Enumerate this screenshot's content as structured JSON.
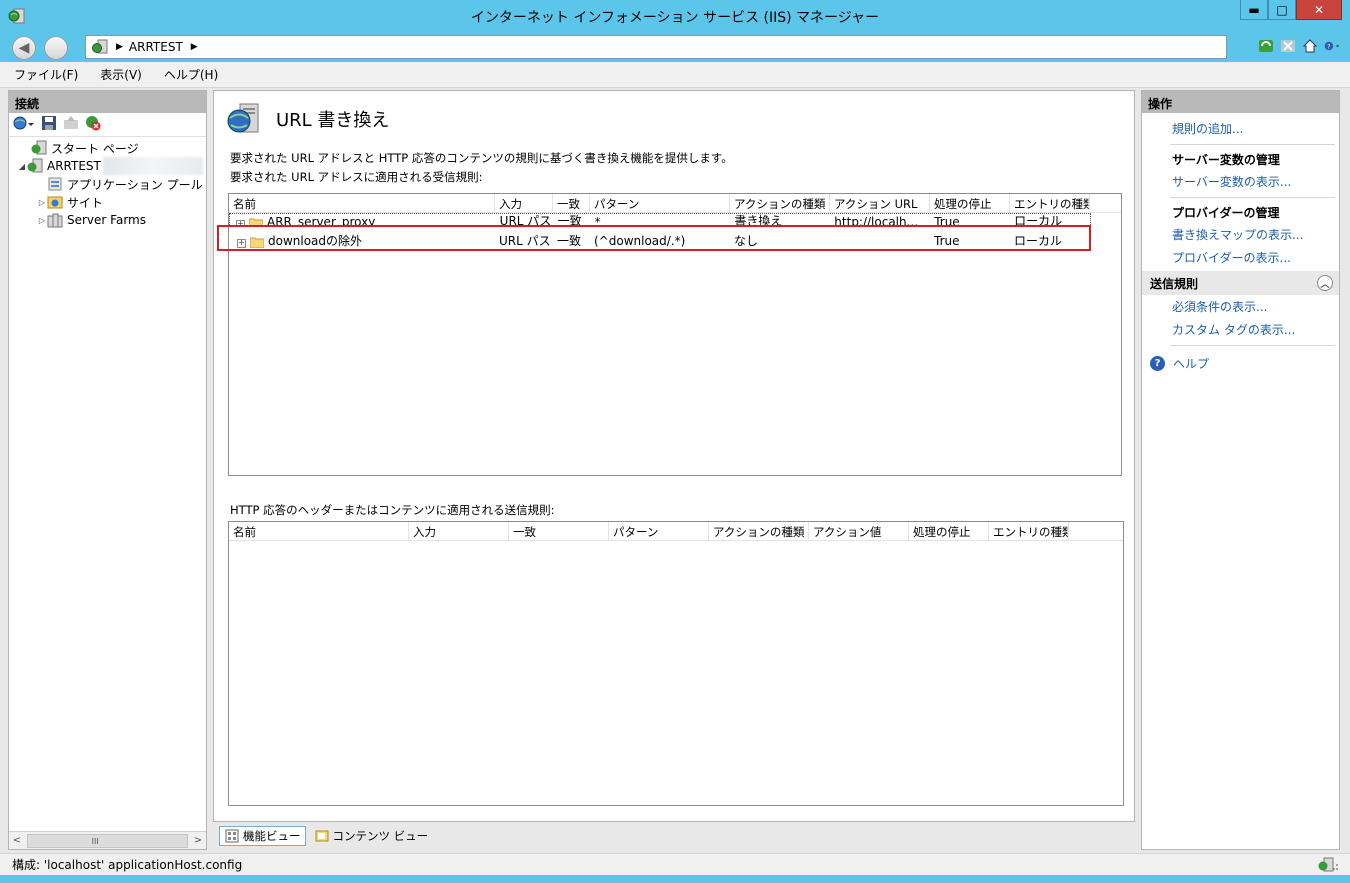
{
  "window": {
    "title": "インターネット インフォメーション サービス (IIS) マネージャー",
    "minimize": "▬",
    "maximize": "□",
    "close": "✕"
  },
  "address": {
    "crumbs": [
      "ARRTEST"
    ]
  },
  "menu": {
    "items": [
      "ファイル(F)",
      "表示(V)",
      "ヘルプ(H)"
    ]
  },
  "connections": {
    "header": "接続",
    "tree": [
      {
        "label": "スタート ページ",
        "icon": "start-page-icon"
      },
      {
        "label": "ARRTEST",
        "icon": "server-icon"
      },
      {
        "label": "アプリケーション プール",
        "icon": "app-pool-icon"
      },
      {
        "label": "サイト",
        "icon": "sites-icon"
      },
      {
        "label": "Server Farms",
        "icon": "server-farms-icon"
      }
    ],
    "scroll_thumb": "III"
  },
  "feature": {
    "title": "URL 書き換え",
    "description": "要求された URL アドレスと HTTP 応答のコンテンツの規則に基づく書き換え機能を提供します。",
    "inbound_label": "要求された URL アドレスに適用される受信規則:",
    "outbound_label": "HTTP 応答のヘッダーまたはコンテンツに適用される送信規則:"
  },
  "inbound_table": {
    "columns": [
      "名前",
      "入力",
      "一致",
      "パターン",
      "アクションの種類",
      "アクション URL",
      "処理の停止",
      "エントリの種類"
    ],
    "rows": [
      [
        "ARR_server_proxy",
        "URL パス",
        "一致",
        "*",
        "書き換え",
        "http://localh...",
        "True",
        "ローカル"
      ],
      [
        "downloadの除外",
        "URL パス",
        "一致",
        "(^download/.*)",
        "なし",
        "",
        "True",
        "ローカル"
      ]
    ]
  },
  "outbound_table": {
    "columns": [
      "名前",
      "入力",
      "一致",
      "パターン",
      "アクションの種類",
      "アクション値",
      "処理の停止",
      "エントリの種類"
    ]
  },
  "bottom_tabs": {
    "feature_view": "機能ビュー",
    "content_view": "コンテンツ ビュー"
  },
  "actions": {
    "header": "操作",
    "add_rule": "規則の追加...",
    "server_vars_title": "サーバー変数の管理",
    "server_vars_link": "サーバー変数の表示...",
    "providers_title": "プロバイダーの管理",
    "rewrite_maps_link": "書き換えマップの表示...",
    "providers_link": "プロバイダーの表示...",
    "outbound_header": "送信規則",
    "preconditions_link": "必須条件の表示...",
    "custom_tags_link": "カスタム タグの表示...",
    "help": "ヘルプ"
  },
  "status": {
    "text": "構成: 'localhost' applicationHost.config"
  },
  "colors": {
    "frame": "#5cc6ea",
    "link": "#1c5eab",
    "highlight": "#d02020"
  }
}
